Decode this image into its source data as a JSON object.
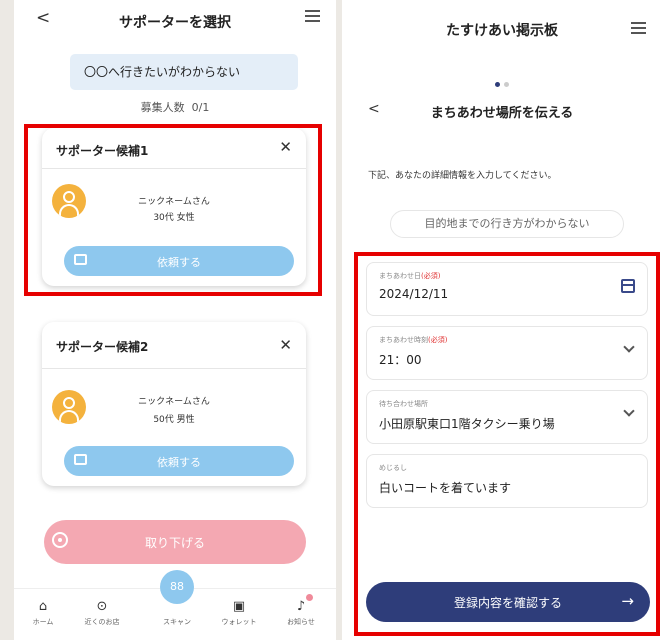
{
  "left": {
    "title": "サポーターを選択",
    "back_icon": "<",
    "need_text": "〇〇へ行きたいがわからない",
    "recruit_label": "募集人数",
    "recruit_value": "0/1",
    "candidates": [
      {
        "title": "サポーター候補1",
        "nickname": "ニックネームさん",
        "details": "30代  女性",
        "request_label": "依頼する"
      },
      {
        "title": "サポーター候補2",
        "nickname": "ニックネームさん",
        "details": "50代  男性",
        "request_label": "依頼する"
      }
    ],
    "close_icon": "✕",
    "withdraw_label": "取り下げる",
    "scan_icon_text": "88",
    "tabs": [
      {
        "label": "ホーム",
        "icon": "⌂"
      },
      {
        "label": "近くのお店",
        "icon": "⊙"
      },
      {
        "label": "スキャン",
        "icon": ""
      },
      {
        "label": "ウォレット",
        "icon": "▣"
      },
      {
        "label": "お知らせ",
        "icon": "♪"
      }
    ]
  },
  "right": {
    "title": "たすけあい掲示板",
    "back_icon": "<",
    "subtitle": "まちあわせ場所を伝える",
    "instruction": "下記、あなたの詳細情報を入力してください。",
    "purpose": "目的地までの行き方がわからない",
    "fields": [
      {
        "label": "まちあわせ日",
        "required": "(必須)",
        "value": "2024/12/11"
      },
      {
        "label": "まちあわせ時刻",
        "required": "(必須)",
        "value": "21：00"
      },
      {
        "label": "待ち合わせ場所",
        "required": "",
        "value": "小田原駅東口1階タクシー乗り場"
      },
      {
        "label": "めじるし",
        "required": "",
        "value": "白いコートを着ています"
      }
    ],
    "confirm_label": "登録内容を確認する",
    "confirm_arrow": "→"
  },
  "colors": {
    "highlight": "#e60000",
    "request_button": "#8ec8ee",
    "withdraw_button": "#f4a8b2",
    "confirm_button": "#2e3d7a",
    "avatar": "#f4b23d"
  }
}
